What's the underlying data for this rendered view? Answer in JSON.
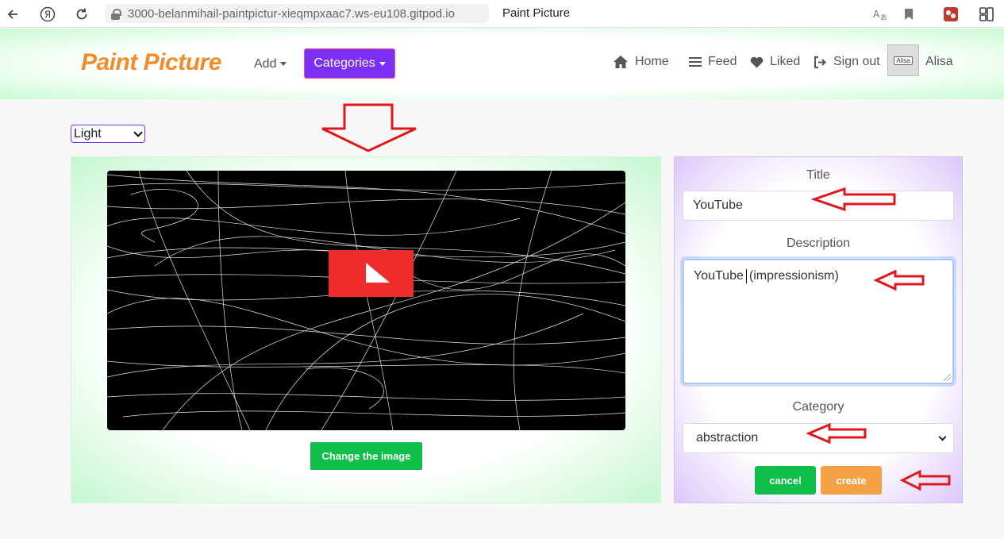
{
  "browser": {
    "url": "3000-belanmihail-paintpictur-xieqmpxaac7.ws-eu108.gitpod.io",
    "tab_title": "Paint Picture"
  },
  "navbar": {
    "brand": "Paint Picture",
    "add_label": "Add",
    "categories_label": "Categories",
    "links": {
      "home": "Home",
      "feed": "Feed",
      "liked": "Liked",
      "signout": "Sign out"
    },
    "avatar_tag": "Alisa",
    "user_name": "Alisa"
  },
  "theme_select": {
    "value": "Light"
  },
  "editor": {
    "change_image_label": "Change the image"
  },
  "form": {
    "title_label": "Title",
    "title_value": "YouTube",
    "description_label": "Description",
    "description_before_caret": "YouTube",
    "description_after_caret": "(impressionism)",
    "category_label": "Category",
    "category_value": "abstraction",
    "cancel_label": "cancel",
    "create_label": "create"
  },
  "colors": {
    "brand": "#f28c28",
    "categories_button": "#7b2ff7",
    "change_image_button": "#0fbf4a",
    "cancel_button": "#0fbf4a",
    "create_button": "#f7a147",
    "annotation_arrow": "#e0161d"
  }
}
